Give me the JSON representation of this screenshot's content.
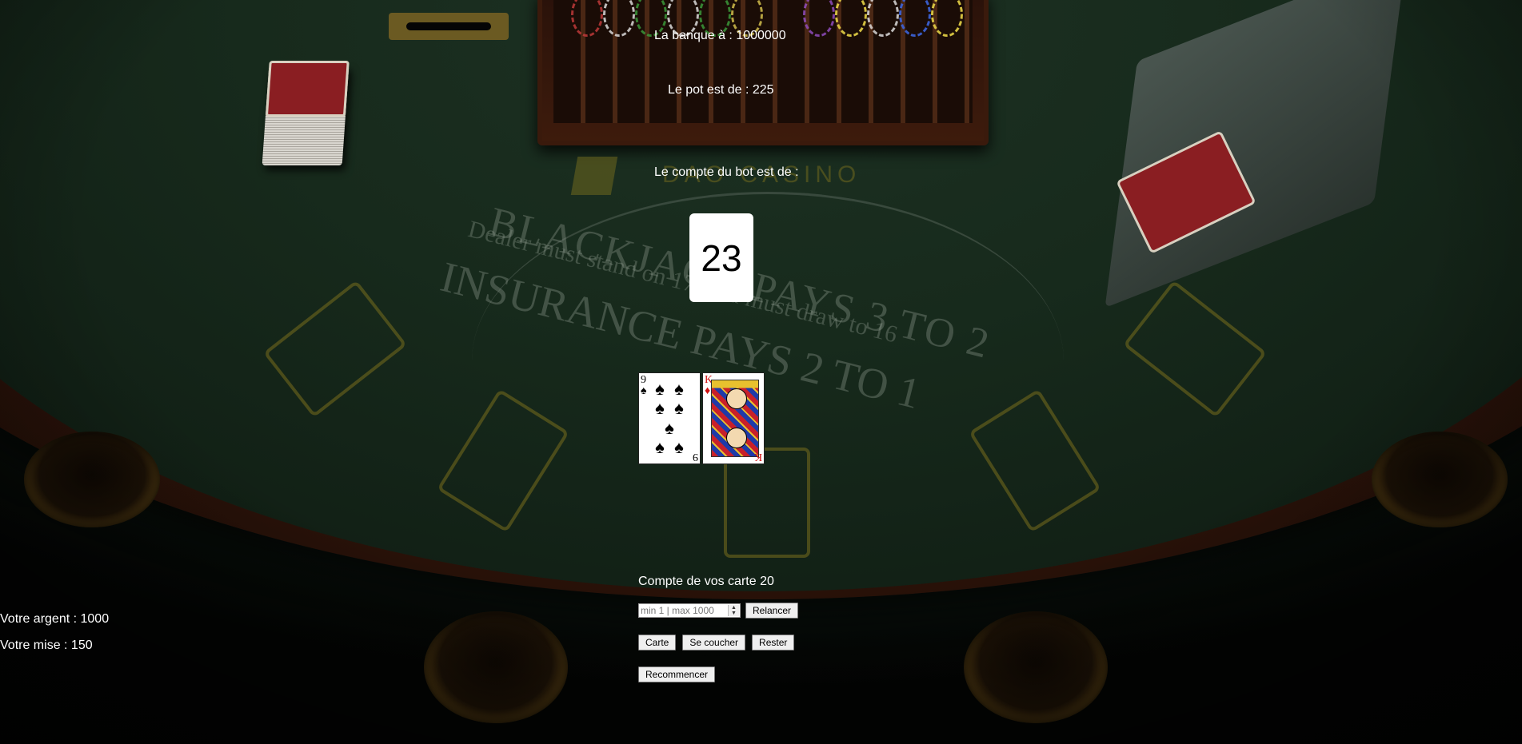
{
  "game": {
    "bank_text": "La banque à : 1000000",
    "pot_text": "Le pot est de : 225",
    "bot_count_label": "Le compte du bot est de :",
    "bot_count_value": "23",
    "player_count_text": "Compte de vos carte 20",
    "money_text": "Votre argent : 1000",
    "stake_text": "Votre mise : 150"
  },
  "player_cards": [
    {
      "rank": "9",
      "suit": "♠",
      "color": "#000000",
      "name": "nine-of-spades"
    },
    {
      "rank": "K",
      "suit": "♦",
      "color": "#d01010",
      "name": "king-of-diamonds"
    }
  ],
  "bet": {
    "placeholder": "min 1 | max 1000",
    "raise_label": "Relancer"
  },
  "actions": {
    "card_label": "Carte",
    "fold_label": "Se coucher",
    "stand_label": "Rester",
    "restart_label": "Recommencer"
  },
  "table_print": {
    "line1": "BLACKJACK PAYS 3 TO 2",
    "line2": "Dealer must stand on 17, and must draw to 16",
    "line3": "INSURANCE PAYS 2 TO 1",
    "logo": "DAO CASINO"
  }
}
